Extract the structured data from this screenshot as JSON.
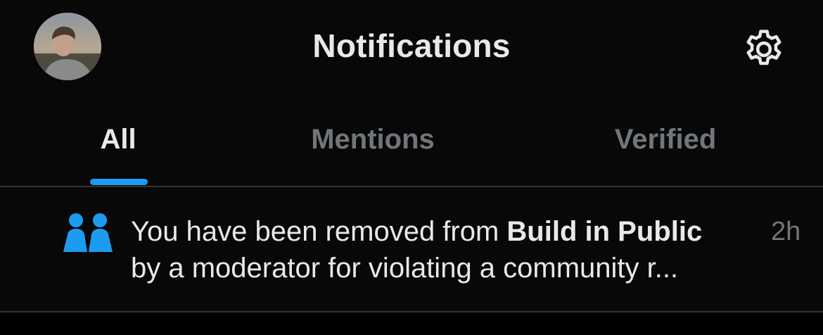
{
  "header": {
    "title": "Notifications",
    "avatar_icon": "user-avatar",
    "settings_icon": "gear-icon"
  },
  "tabs": [
    {
      "label": "All",
      "active": true
    },
    {
      "label": "Mentions",
      "active": false
    },
    {
      "label": "Verified",
      "active": false
    }
  ],
  "colors": {
    "accent": "#1d9bf0",
    "text_primary": "#e7e9ea",
    "text_secondary": "#71767b",
    "background": "#000000",
    "divider": "#2f3336"
  },
  "notifications": [
    {
      "icon": "community-icon",
      "text_prefix": "You have been removed from ",
      "community_name": "Build in Public",
      "text_line2": "by a moderator for violating a community r...",
      "time": "2h"
    }
  ]
}
